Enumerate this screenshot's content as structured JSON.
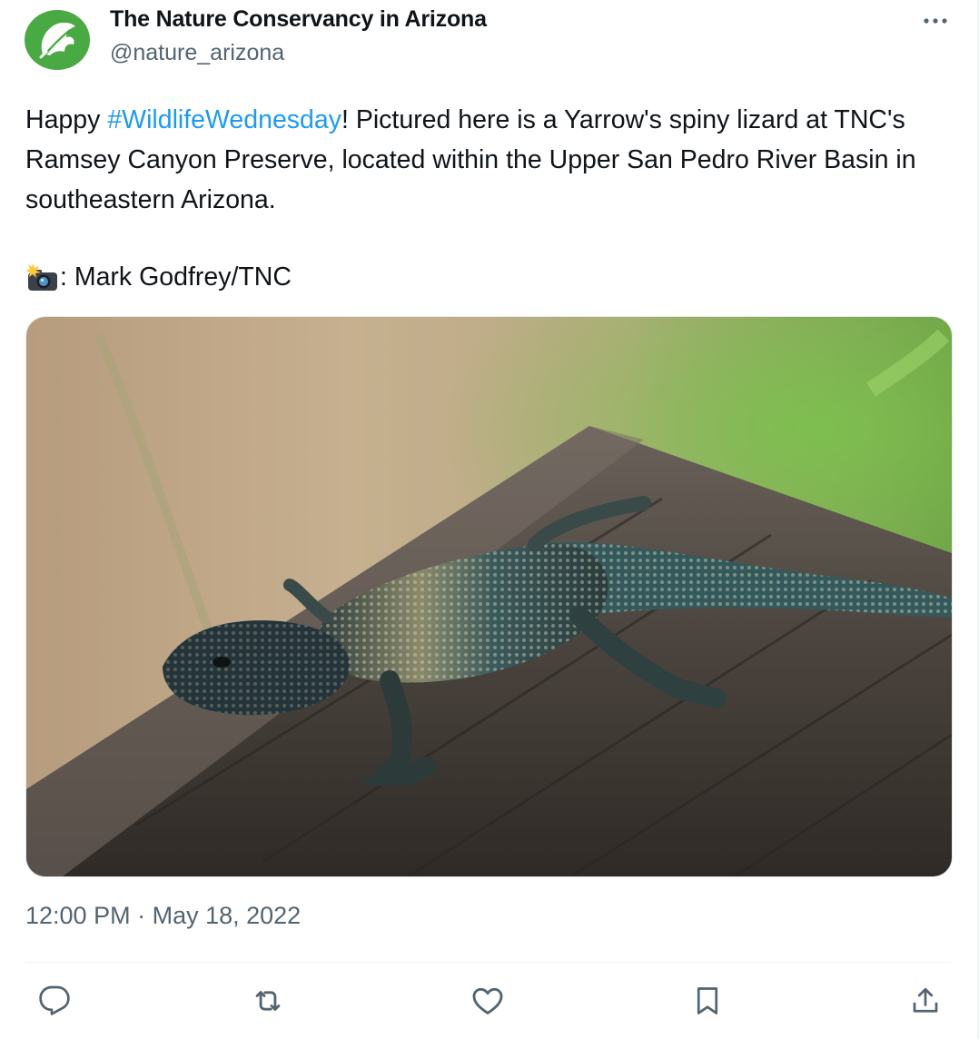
{
  "author": {
    "name": "The Nature Conservancy in Arizona",
    "handle": "@nature_arizona"
  },
  "tweet": {
    "text_before": "Happy ",
    "hashtag": "#WildlifeWednesday",
    "text_after": "! Pictured here is a Yarrow's spiny lizard at TNC's Ramsey Canyon Preserve, located within the Upper San Pedro River Basin in southeastern Arizona.",
    "credit_emoji": "camera-with-flash-icon",
    "credit_text": ": Mark Godfrey/TNC"
  },
  "timestamp": {
    "time": "12:00 PM",
    "separator": " · ",
    "date": "May 18, 2022"
  },
  "actions": [
    "reply-icon",
    "retweet-icon",
    "like-icon",
    "bookmark-icon",
    "share-icon"
  ],
  "colors": {
    "link": "#1d9bf0",
    "secondary": "#536471",
    "logo": "#49a942"
  }
}
